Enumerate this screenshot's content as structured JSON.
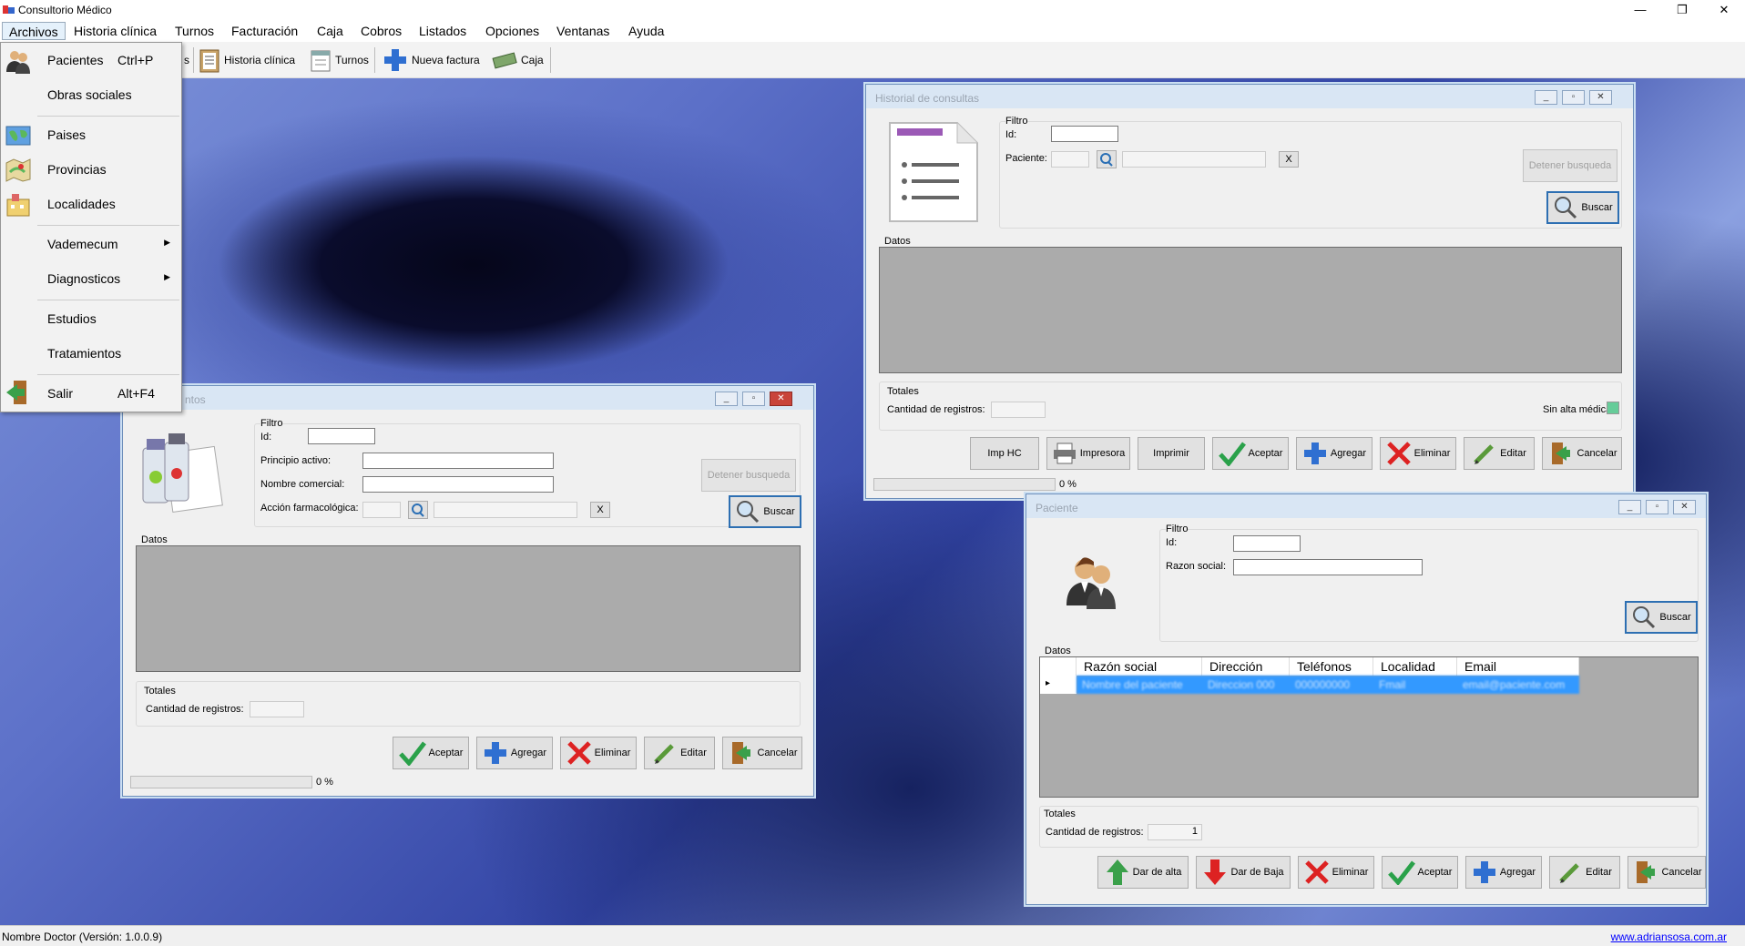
{
  "app": {
    "title": "Consultorio Médico",
    "minimize": "—",
    "restore": "❐",
    "close": "✕"
  },
  "menu": [
    "Archivos",
    "Historia clínica",
    "Turnos",
    "Facturación",
    "Caja",
    "Cobros",
    "Listados",
    "Opciones",
    "Ventanas",
    "Ayuda"
  ],
  "toolbar": {
    "partial_label": "s",
    "historia": "Historia clínica",
    "turnos": "Turnos",
    "nueva_factura": "Nueva factura",
    "caja": "Caja"
  },
  "archivos_menu": {
    "pacientes": "Pacientes",
    "pacientes_shortcut": "Ctrl+P",
    "obras_sociales": "Obras sociales",
    "paises": "Paises",
    "provincias": "Provincias",
    "localidades": "Localidades",
    "vademecum": "Vademecum",
    "diagnosticos": "Diagnosticos",
    "estudios": "Estudios",
    "tratamientos": "Tratamientos",
    "salir": "Salir",
    "salir_shortcut": "Alt+F4"
  },
  "medicamentos_window": {
    "title_visible": "ntos",
    "filtro": "Filtro",
    "id": "Id:",
    "principio_activo": "Principio activo:",
    "nombre_comercial": "Nombre comercial:",
    "accion_farmacologica": "Acción farmacológica:",
    "clear": "X",
    "detener": "Detener busqueda",
    "buscar": "Buscar",
    "datos": "Datos",
    "totales": "Totales",
    "cantidad": "Cantidad de registros:",
    "cantidad_value": "",
    "aceptar": "Aceptar",
    "agregar": "Agregar",
    "eliminar": "Eliminar",
    "editar": "Editar",
    "cancelar": "Cancelar",
    "progress": "0 %",
    "progress_value": 0
  },
  "historial_window": {
    "title": "Historial de consultas",
    "filtro": "Filtro",
    "id": "Id:",
    "paciente": "Paciente:",
    "clear": "X",
    "detener": "Detener busqueda",
    "buscar": "Buscar",
    "datos": "Datos",
    "totales": "Totales",
    "cantidad": "Cantidad de registros:",
    "sin_alta": "Sin alta médica:",
    "imp_hc": "Imp HC",
    "impresora": "Impresora",
    "imprimir": "Imprimir",
    "aceptar": "Aceptar",
    "agregar": "Agregar",
    "eliminar": "Eliminar",
    "editar": "Editar",
    "cancelar": "Cancelar",
    "progress": "0 %",
    "progress_value": 0,
    "sin_alta_color": "#66cc99"
  },
  "paciente_window": {
    "title": "Paciente",
    "filtro": "Filtro",
    "id": "Id:",
    "razon_social_label": "Razon social:",
    "buscar": "Buscar",
    "datos": "Datos",
    "columns": [
      "Razón social",
      "Dirección",
      "Teléfonos",
      "Localidad",
      "Email"
    ],
    "row": [
      "Nombre del paciente",
      "Direccion 000",
      "000000000",
      "Fmail",
      "email@paciente.com"
    ],
    "row_marker": "▸",
    "totales": "Totales",
    "cantidad": "Cantidad de registros:",
    "cantidad_value": "1",
    "dar_alta": "Dar de alta",
    "dar_baja": "Dar de Baja",
    "eliminar": "Eliminar",
    "aceptar": "Aceptar",
    "agregar": "Agregar",
    "editar": "Editar",
    "cancelar": "Cancelar"
  },
  "status": {
    "left": "Nombre Doctor  (Versión: 1.0.0.9)",
    "right": "www.adriansosa.com.ar"
  },
  "colors": {
    "selection": "#3399ff",
    "grid_bg": "#ababab",
    "window_border": "#6d8fbb"
  }
}
